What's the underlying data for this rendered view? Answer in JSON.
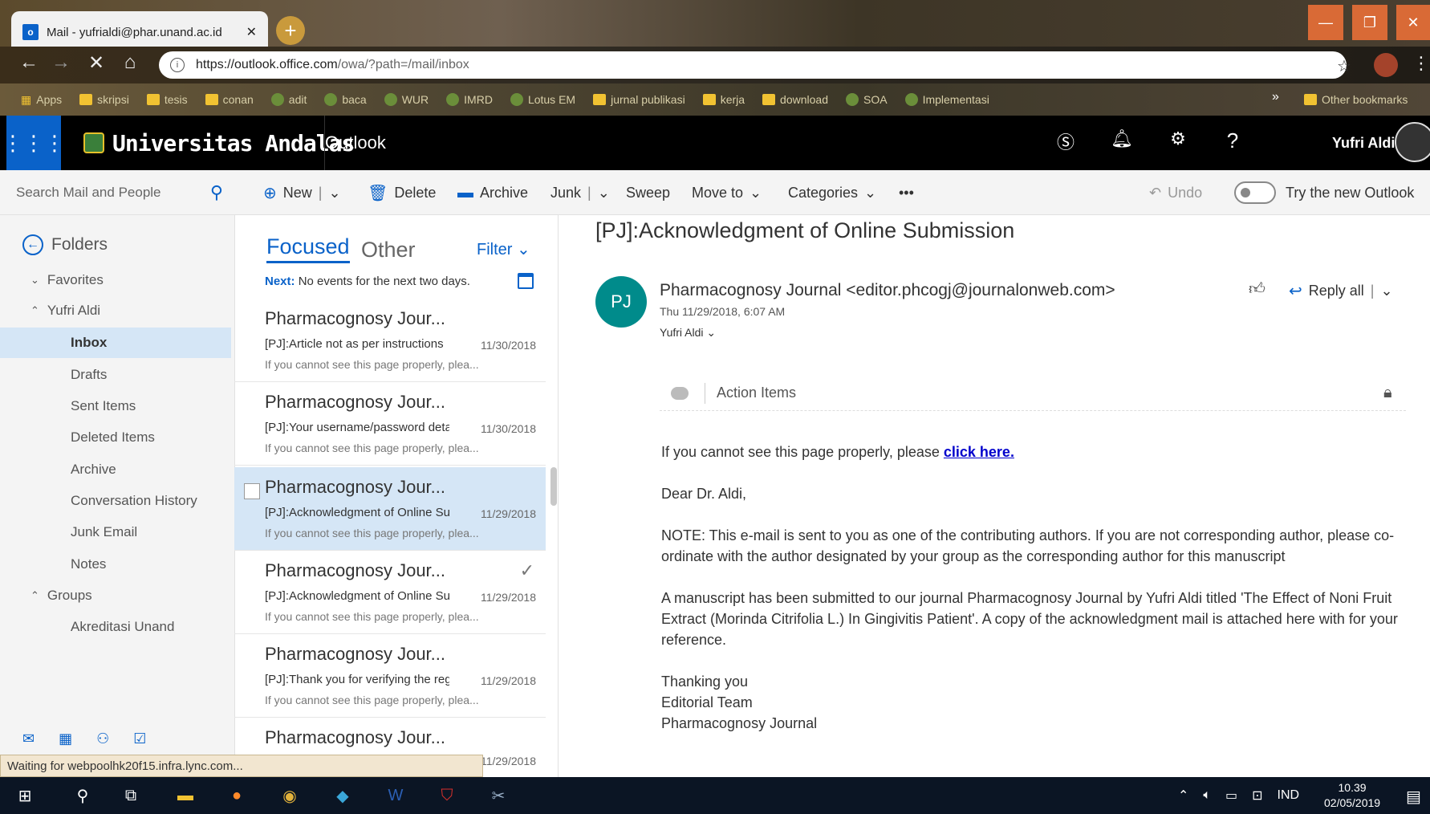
{
  "browser": {
    "tab_title": "Mail - yufrialdi@phar.unand.ac.id",
    "url_host": "https://outlook.office.com",
    "url_rest": "/owa/?path=/mail/inbox",
    "bookmarks": [
      "Apps",
      "skripsi",
      "tesis",
      "conan",
      "adit",
      "baca",
      "WUR",
      "IMRD",
      "Lotus EM",
      "jurnal publikasi",
      "kerja",
      "download",
      "SOA",
      "Implementasi"
    ],
    "other_bookmarks": "Other bookmarks",
    "more": "»"
  },
  "header": {
    "brand": "Universitas Andalas",
    "app": "Outlook",
    "user": "Yufri Aldi"
  },
  "toolbar": {
    "search_placeholder": "Search Mail and People",
    "new": "New",
    "delete": "Delete",
    "archive": "Archive",
    "junk": "Junk",
    "sweep": "Sweep",
    "move_to": "Move to",
    "categories": "Categories",
    "more": "•••",
    "undo": "Undo",
    "try_new": "Try the new Outlook"
  },
  "folders": {
    "heading": "Folders",
    "favorites": "Favorites",
    "account": "Yufri Aldi",
    "items": [
      "Inbox",
      "Drafts",
      "Sent Items",
      "Deleted Items",
      "Archive",
      "Conversation History",
      "Junk Email",
      "Notes"
    ],
    "groups": "Groups",
    "group_items": [
      "Akreditasi Unand"
    ]
  },
  "list": {
    "focused": "Focused",
    "other": "Other",
    "filter": "Filter",
    "next_label": "Next:",
    "next_text": "No events for the next two days.",
    "messages": [
      {
        "sender": "Pharmacognosy Jour...",
        "subject": "[PJ]:Article not as per instructions",
        "date": "11/30/2018",
        "preview": "If you cannot see this page properly, plea..."
      },
      {
        "sender": "Pharmacognosy Jour...",
        "subject": "[PJ]:Your username/password details",
        "date": "11/30/2018",
        "preview": "If you cannot see this page properly, plea..."
      },
      {
        "sender": "Pharmacognosy Jour...",
        "subject": "[PJ]:Acknowledgment of Online Submission",
        "date": "11/29/2018",
        "preview": "If you cannot see this page properly, plea..."
      },
      {
        "sender": "Pharmacognosy Jour...",
        "subject": "[PJ]:Acknowledgment of Online Submission",
        "date": "11/29/2018",
        "preview": "If you cannot see this page properly, plea..."
      },
      {
        "sender": "Pharmacognosy Jour...",
        "subject": "[PJ]:Thank you for verifying the registration",
        "date": "11/29/2018",
        "preview": "If you cannot see this page properly, plea..."
      },
      {
        "sender": "Pharmacognosy Jour...",
        "subject": "",
        "date": "11/29/2018",
        "preview": ""
      }
    ]
  },
  "status": "Waiting for webpoolhk20f15.infra.lync.com...",
  "reading": {
    "subject": "[PJ]:Acknowledgment of Online Submission",
    "initials": "PJ",
    "from": "Pharmacognosy Journal <editor.phcogj@journalonweb.com>",
    "date": "Thu 11/29/2018, 6:07 AM",
    "to": "Yufri Aldi",
    "reply_all": "Reply all",
    "action_items": "Action Items",
    "body": {
      "line1_pre": "If you cannot see this page properly, please ",
      "line1_link": "click here.",
      "greeting": "Dear Dr. Aldi,",
      "note": "NOTE: This e-mail is sent to you as one of the contributing authors. If you are not corresponding author, please co-ordinate with the author designated by your group as the corresponding author for this manuscript",
      "para": "A manuscript has been submitted to our journal Pharmacognosy Journal by Yufri Aldi titled 'The Effect of Noni Fruit Extract (Morinda Citrifolia L.) In Gingivitis Patient'. A copy of the acknowledgment mail is attached here with for your reference.",
      "sign1": "Thanking you",
      "sign2": "Editorial Team",
      "sign3": "Pharmacognosy Journal"
    }
  },
  "taskbar": {
    "lang": "IND",
    "time": "10.39",
    "date": "02/05/2019"
  }
}
